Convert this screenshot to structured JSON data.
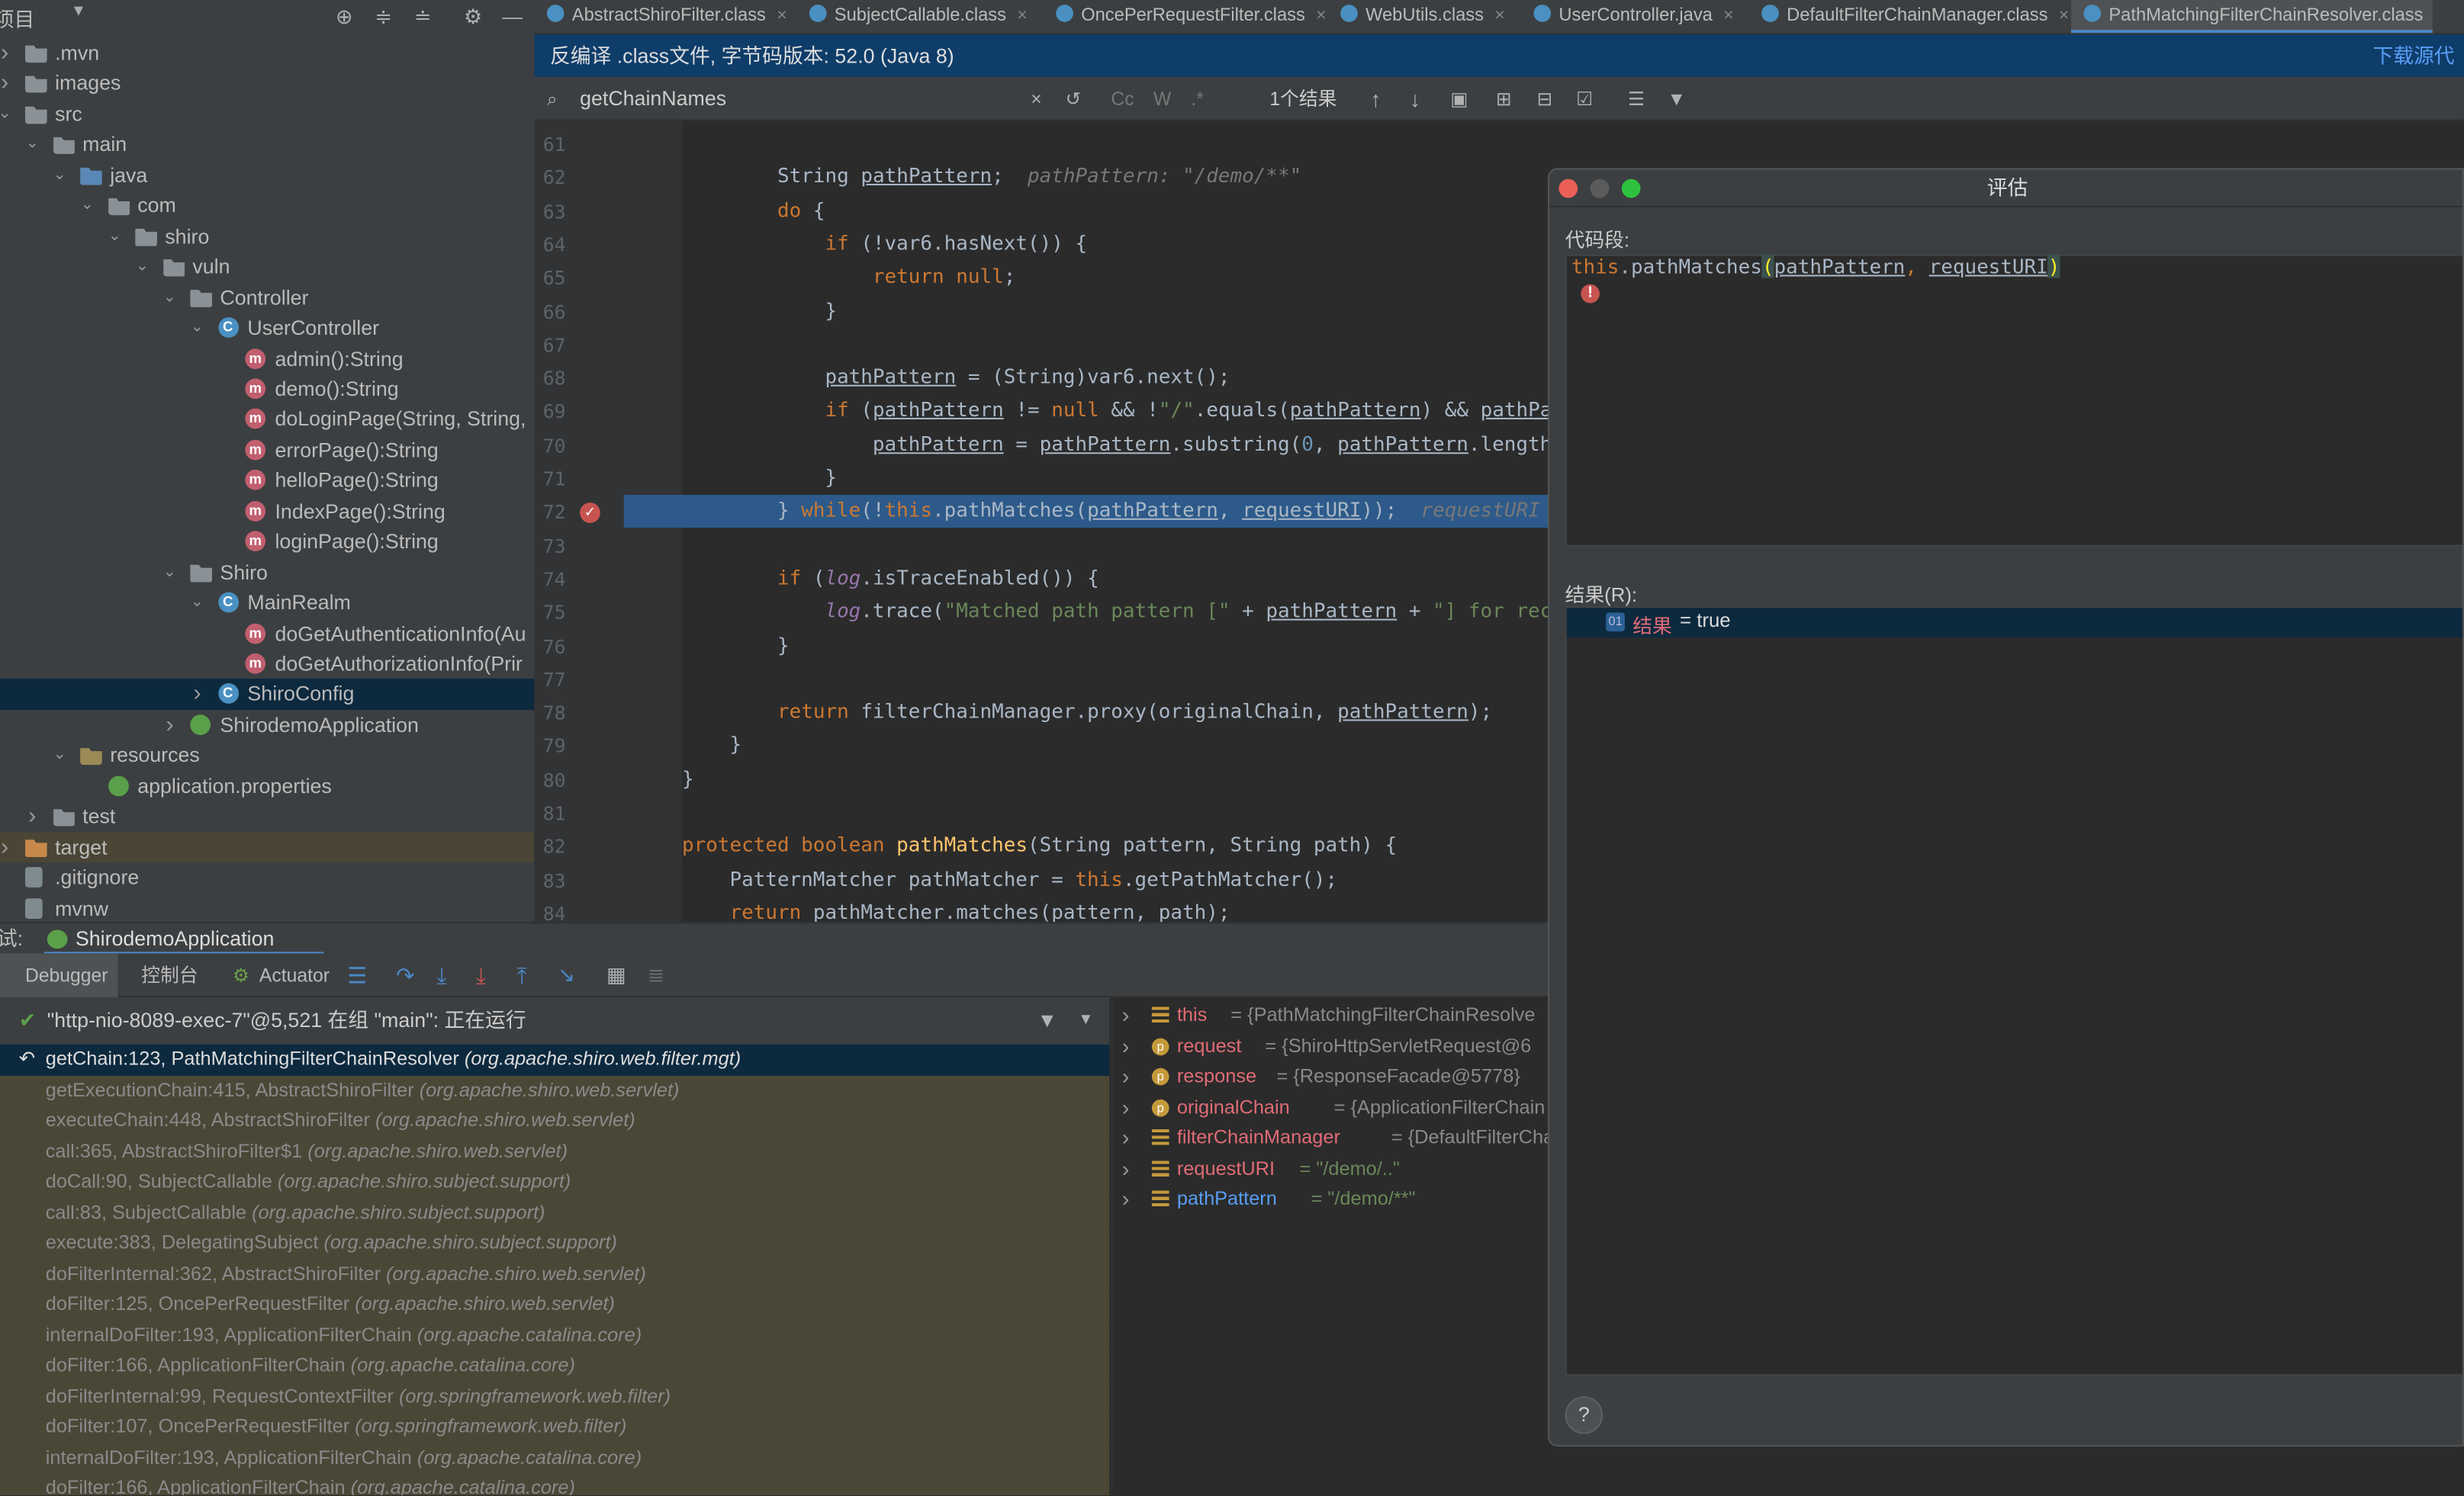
{
  "project_panel": {
    "title": "项目",
    "tree": [
      {
        "label": ".mvn",
        "icon": "folder",
        "depth": 0,
        "arrow": "closed"
      },
      {
        "label": "images",
        "icon": "folder",
        "depth": 0,
        "arrow": "closed"
      },
      {
        "label": "src",
        "icon": "folder",
        "depth": 0,
        "arrow": "open"
      },
      {
        "label": "main",
        "icon": "folder",
        "depth": 1,
        "arrow": "open"
      },
      {
        "label": "java",
        "icon": "folder-src",
        "depth": 2,
        "arrow": "open"
      },
      {
        "label": "com",
        "icon": "package",
        "depth": 3,
        "arrow": "open"
      },
      {
        "label": "shiro",
        "icon": "package",
        "depth": 4,
        "arrow": "open"
      },
      {
        "label": "vuln",
        "icon": "package",
        "depth": 5,
        "arrow": "open"
      },
      {
        "label": "Controller",
        "icon": "package",
        "depth": 6,
        "arrow": "open"
      },
      {
        "label": "UserController",
        "icon": "class",
        "depth": 7,
        "arrow": "open"
      },
      {
        "label": "admin():String",
        "icon": "method",
        "depth": 8,
        "arrow": ""
      },
      {
        "label": "demo():String",
        "icon": "method",
        "depth": 8,
        "arrow": ""
      },
      {
        "label": "doLoginPage(String, String,",
        "icon": "method",
        "depth": 8,
        "arrow": ""
      },
      {
        "label": "errorPage():String",
        "icon": "method",
        "depth": 8,
        "arrow": ""
      },
      {
        "label": "helloPage():String",
        "icon": "method",
        "depth": 8,
        "arrow": ""
      },
      {
        "label": "IndexPage():String",
        "icon": "method",
        "depth": 8,
        "arrow": ""
      },
      {
        "label": "loginPage():String",
        "icon": "method",
        "depth": 8,
        "arrow": ""
      },
      {
        "label": "Shiro",
        "icon": "package",
        "depth": 6,
        "arrow": "open"
      },
      {
        "label": "MainRealm",
        "icon": "class",
        "depth": 7,
        "arrow": "open"
      },
      {
        "label": "doGetAuthenticationInfo(Au",
        "icon": "method",
        "depth": 8,
        "arrow": ""
      },
      {
        "label": "doGetAuthorizationInfo(Prir",
        "icon": "method",
        "depth": 8,
        "arrow": ""
      },
      {
        "label": "ShiroConfig",
        "icon": "class",
        "depth": 7,
        "arrow": "closed",
        "selected": true
      },
      {
        "label": "ShirodemoApplication",
        "icon": "app",
        "depth": 6,
        "arrow": "closed"
      },
      {
        "label": "resources",
        "icon": "folder-res",
        "depth": 2,
        "arrow": "open"
      },
      {
        "label": "application.properties",
        "icon": "app",
        "depth": 3,
        "arrow": ""
      },
      {
        "label": "test",
        "icon": "folder",
        "depth": 1,
        "arrow": "closed"
      },
      {
        "label": "target",
        "icon": "folder-target",
        "depth": 0,
        "arrow": "closed",
        "target": true
      },
      {
        "label": ".gitignore",
        "icon": "file",
        "depth": 0,
        "arrow": ""
      },
      {
        "label": "mvnw",
        "icon": "file",
        "depth": 0,
        "arrow": ""
      }
    ]
  },
  "tabs": [
    {
      "label": "AbstractShiroFilter.class"
    },
    {
      "label": "SubjectCallable.class"
    },
    {
      "label": "OncePerRequestFilter.class"
    },
    {
      "label": "WebUtils.class"
    },
    {
      "label": "UserController.java"
    },
    {
      "label": "DefaultFilterChainManager.class"
    },
    {
      "label": "PathMatchingFilterChainResolver.class",
      "active": true
    }
  ],
  "info_bar": {
    "text": "反编译 .class文件, 字节码版本: 52.0 (Java 8)",
    "link": "下载源代码"
  },
  "find_bar": {
    "query": "getChainNames",
    "options": [
      "Cc",
      "W",
      ".*"
    ],
    "result": "1个结果"
  },
  "editor": {
    "lines": [
      {
        "n": "61",
        "html": ""
      },
      {
        "n": "62",
        "html": "        <span>String</span> <span class='ul'>pathPattern</span>;  <span class='hint'>pathPattern: \"/demo/**\"</span>"
      },
      {
        "n": "63",
        "html": "        <span class='kw'>do</span> {"
      },
      {
        "n": "64",
        "html": "            <span class='kw'>if</span> (!var6.hasNext()) {"
      },
      {
        "n": "65",
        "html": "                <span class='kw'>return null</span>;"
      },
      {
        "n": "66",
        "html": "            }"
      },
      {
        "n": "67",
        "html": ""
      },
      {
        "n": "68",
        "html": "            <span class='ul'>pathPattern</span> = (String)var6.next();"
      },
      {
        "n": "69",
        "html": "            <span class='kw'>if</span> (<span class='ul'>pathPattern</span> != <span class='kw'>null</span> &amp;&amp; !<span class='str'>\"/\"</span>.equals(<span class='ul'>pathPattern</span>) &amp;&amp; <span class='ul'>pathPa</span>"
      },
      {
        "n": "70",
        "html": "                <span class='ul'>pathPattern</span> = <span class='ul'>pathPattern</span>.substring(<span class='num'>0</span>, <span class='ul'>pathPattern</span>.length"
      },
      {
        "n": "71",
        "html": "            }"
      },
      {
        "n": "72",
        "html": "        } <span class='kw'>while</span>(!<span class='kw'>this</span>.pathMatches(<span class='ul'>pathPattern</span>, <span class='ul'>requestURI</span>));  <span class='hint'>requestURI</span>",
        "highlight": true
      },
      {
        "n": "73",
        "html": ""
      },
      {
        "n": "74",
        "html": "        <span class='kw'>if</span> (<span class='fld'>log</span>.isTraceEnabled()) {"
      },
      {
        "n": "75",
        "html": "            <span class='fld'>log</span>.trace(<span class='str'>\"Matched path pattern [\"</span> + <span class='ul'>pathPattern</span> + <span class='str'>\"] for rec</span>"
      },
      {
        "n": "76",
        "html": "        }"
      },
      {
        "n": "77",
        "html": ""
      },
      {
        "n": "78",
        "html": "        <span class='kw'>return</span> filterChainManager.proxy(originalChain, <span class='ul'>pathPattern</span>);"
      },
      {
        "n": "79",
        "html": "    }"
      },
      {
        "n": "80",
        "html": "}"
      },
      {
        "n": "81",
        "html": ""
      },
      {
        "n": "82",
        "html": "<span class='kw'>protected boolean</span> <span class='fn'>pathMatches</span>(String pattern, String path) {"
      },
      {
        "n": "83",
        "html": "    PatternMatcher pathMatcher = <span class='kw'>this</span>.getPathMatcher();"
      },
      {
        "n": "84",
        "html": "    <span class='kw'>return</span> pathMatcher.matches(pattern, path);"
      }
    ]
  },
  "eval_dialog": {
    "title": "评估",
    "code_label": "代码段:",
    "code_html": "<span class='kw'>this</span>.pathMatches<span style='background:#3b514d;color:#ffef28'>(</span><span class='ul'>pathPattern</span><span class='kw'>,</span> <span class='ul'>requestURI</span><span style='background:#3b514d;color:#ffef28'>)</span>",
    "result_label": "结果(R):",
    "result_name": "结果",
    "result_value": "= true",
    "help": "?"
  },
  "debug": {
    "title_prefix": "试:",
    "run_config": "ShirodemoApplication",
    "tabs": [
      "Debugger",
      "控制台",
      "Actuator"
    ],
    "thread": "\"http-nio-8089-exec-7\"@5,521 在组 \"main\": 正在运行",
    "frames": [
      {
        "method": "getChain:123, PathMatchingFilterChainResolver",
        "pkg": "(org.apache.shiro.web.filter.mgt)",
        "current": true
      },
      {
        "method": "getExecutionChain:415, AbstractShiroFilter",
        "pkg": "(org.apache.shiro.web.servlet)"
      },
      {
        "method": "executeChain:448, AbstractShiroFilter",
        "pkg": "(org.apache.shiro.web.servlet)"
      },
      {
        "method": "call:365, AbstractShiroFilter$1",
        "pkg": "(org.apache.shiro.web.servlet)"
      },
      {
        "method": "doCall:90, SubjectCallable",
        "pkg": "(org.apache.shiro.subject.support)"
      },
      {
        "method": "call:83, SubjectCallable",
        "pkg": "(org.apache.shiro.subject.support)"
      },
      {
        "method": "execute:383, DelegatingSubject",
        "pkg": "(org.apache.shiro.subject.support)"
      },
      {
        "method": "doFilterInternal:362, AbstractShiroFilter",
        "pkg": "(org.apache.shiro.web.servlet)"
      },
      {
        "method": "doFilter:125, OncePerRequestFilter",
        "pkg": "(org.apache.shiro.web.servlet)"
      },
      {
        "method": "internalDoFilter:193, ApplicationFilterChain",
        "pkg": "(org.apache.catalina.core)"
      },
      {
        "method": "doFilter:166, ApplicationFilterChain",
        "pkg": "(org.apache.catalina.core)"
      },
      {
        "method": "doFilterInternal:99, RequestContextFilter",
        "pkg": "(org.springframework.web.filter)"
      },
      {
        "method": "doFilter:107, OncePerRequestFilter",
        "pkg": "(org.springframework.web.filter)"
      },
      {
        "method": "internalDoFilter:193, ApplicationFilterChain",
        "pkg": "(org.apache.catalina.core)"
      },
      {
        "method": "doFilter:166, ApplicationFilterChain",
        "pkg": "(org.apache.catalina.core)"
      }
    ],
    "variables": [
      {
        "name": "this",
        "value": "= {PathMatchingFilterChainResolve",
        "icon": "field",
        "name_color": "#e06c75"
      },
      {
        "name": "request",
        "value": "= {ShiroHttpServletRequest@6",
        "icon": "param",
        "name_color": "#e06c75"
      },
      {
        "name": "response",
        "value": "= {ResponseFacade@5778}",
        "icon": "param",
        "name_color": "#e06c75"
      },
      {
        "name": "originalChain",
        "value": "= {ApplicationFilterChain",
        "icon": "param",
        "name_color": "#e06c75"
      },
      {
        "name": "filterChainManager",
        "value": "= {DefaultFilterChai",
        "icon": "field",
        "name_color": "#e06c75"
      },
      {
        "name": "requestURI",
        "value": "= \"/demo/..\"",
        "icon": "field",
        "name_color": "#e06c75",
        "string": true
      },
      {
        "name": "pathPattern",
        "value": "= \"/demo/**\"",
        "icon": "field",
        "name_color": "#589df6",
        "string": true
      }
    ]
  }
}
